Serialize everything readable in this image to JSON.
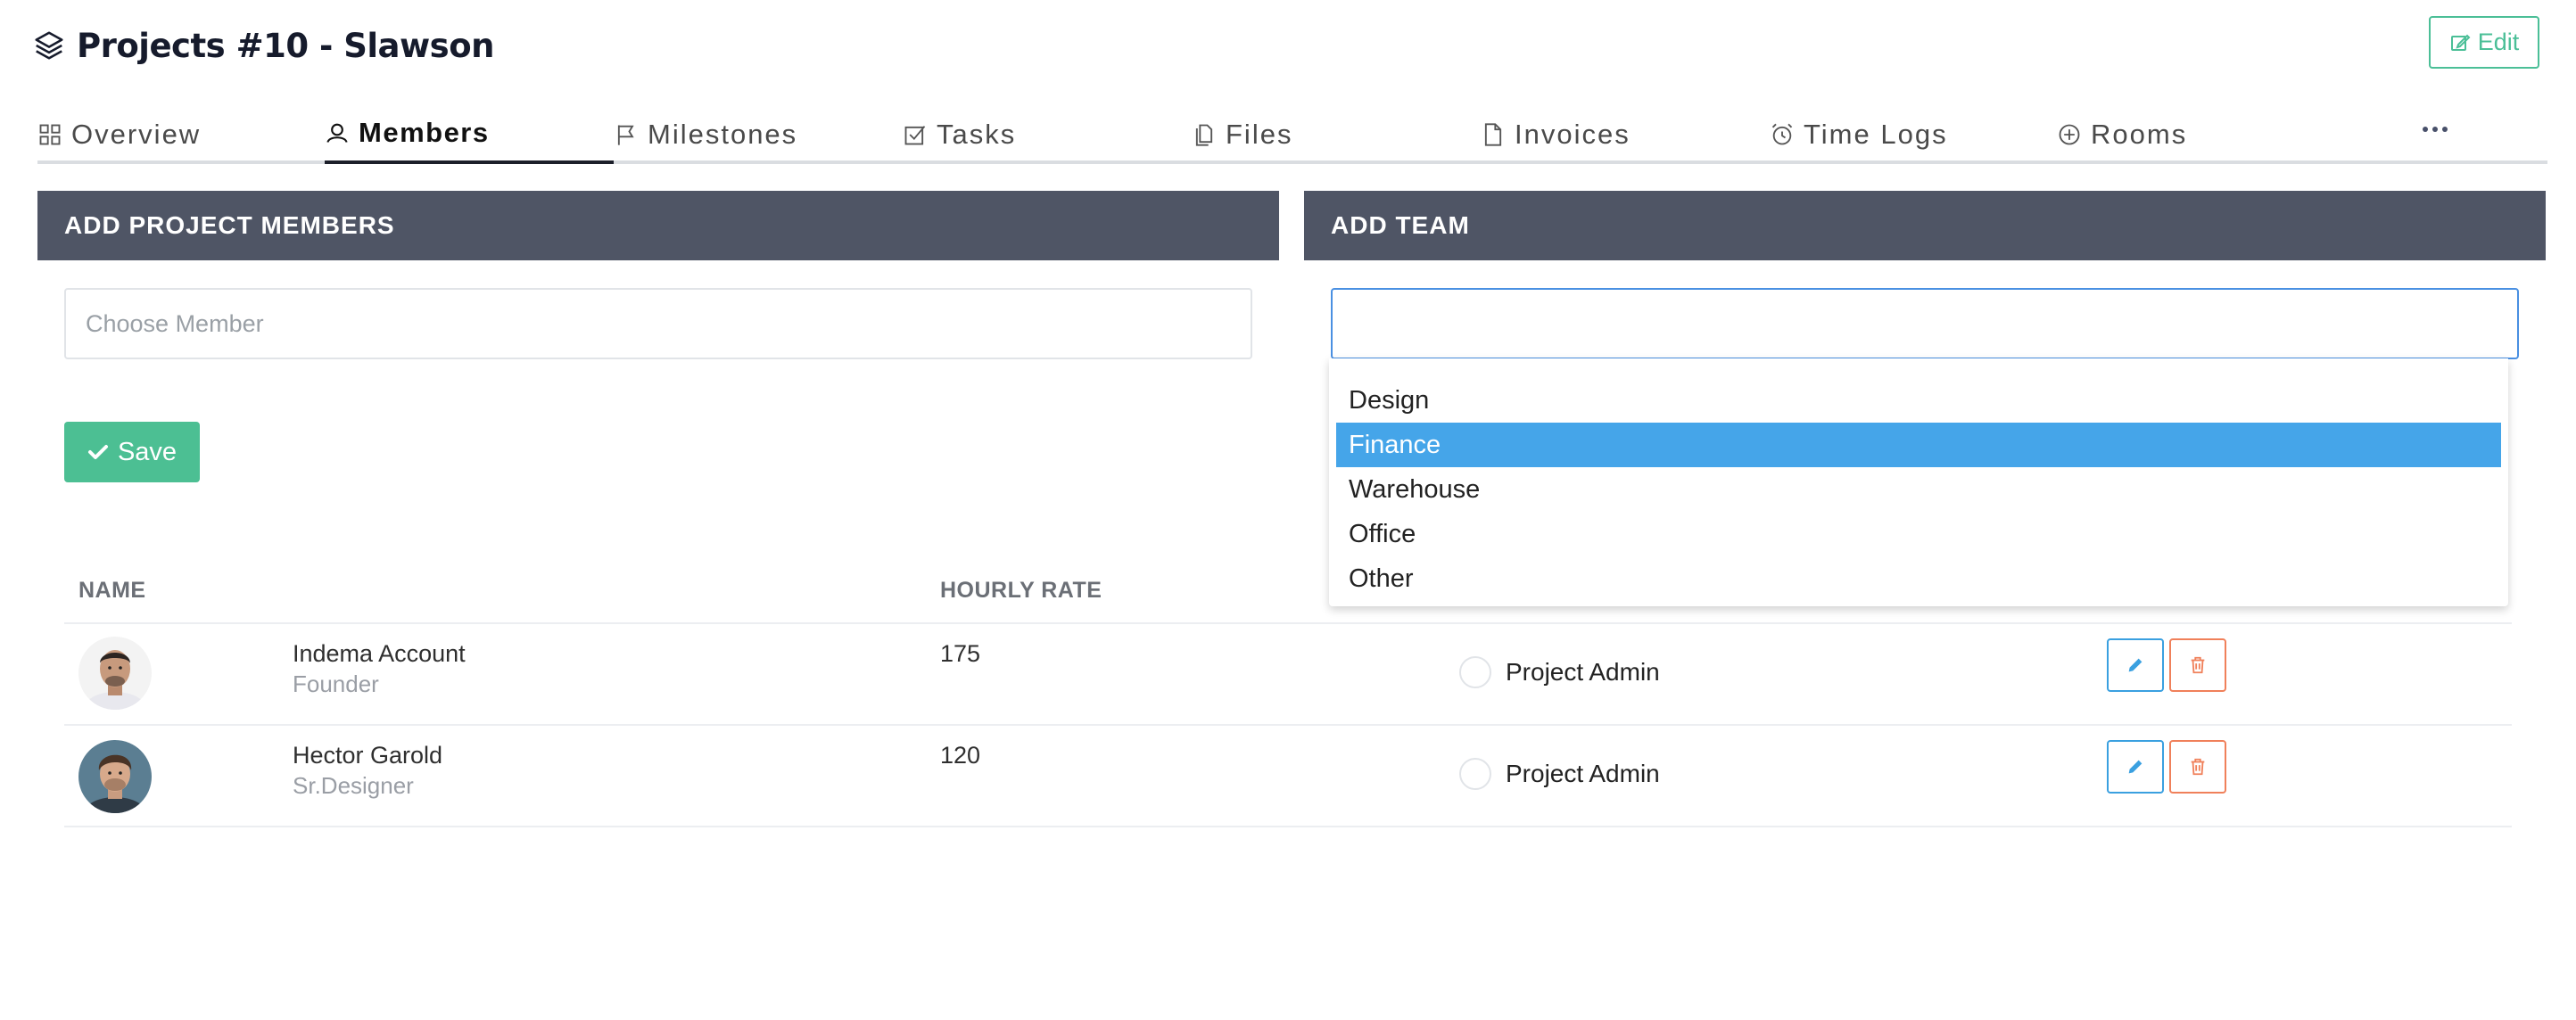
{
  "header": {
    "title": "Projects #10 - Slawson",
    "edit_label": "Edit",
    "colors": {
      "accent": "#4bbf97",
      "title": "#161b2c"
    }
  },
  "tabs": [
    {
      "label": "Overview",
      "icon": "grid-icon"
    },
    {
      "label": "Members",
      "icon": "user-icon",
      "active": true
    },
    {
      "label": "Milestones",
      "icon": "flag-icon"
    },
    {
      "label": "Tasks",
      "icon": "checkbox-icon"
    },
    {
      "label": "Files",
      "icon": "files-icon"
    },
    {
      "label": "Invoices",
      "icon": "document-icon"
    },
    {
      "label": "Time Logs",
      "icon": "alarm-clock-icon"
    },
    {
      "label": "Rooms",
      "icon": "plus-circle-icon"
    }
  ],
  "add_members": {
    "heading": "ADD PROJECT MEMBERS",
    "placeholder": "Choose Member",
    "save_label": "Save"
  },
  "add_team": {
    "heading": "ADD TEAM",
    "value": "",
    "options": [
      "Design",
      "Finance",
      "Warehouse",
      "Office",
      "Other"
    ],
    "highlighted": "Finance",
    "highlight_color": "#45a5e9"
  },
  "table": {
    "headers": {
      "name": "NAME",
      "rate": "HOURLY RATE"
    },
    "rows": [
      {
        "name": "Indema Account",
        "role": "Founder",
        "rate": "175",
        "permission": "Project Admin"
      },
      {
        "name": "Hector Garold",
        "role": "Sr.Designer",
        "rate": "120",
        "permission": "Project Admin"
      }
    ]
  },
  "colors": {
    "panel_header": "#4f5565",
    "save": "#4cbf93",
    "edit_action": "#3aa0e0",
    "delete_action": "#f0805a"
  }
}
